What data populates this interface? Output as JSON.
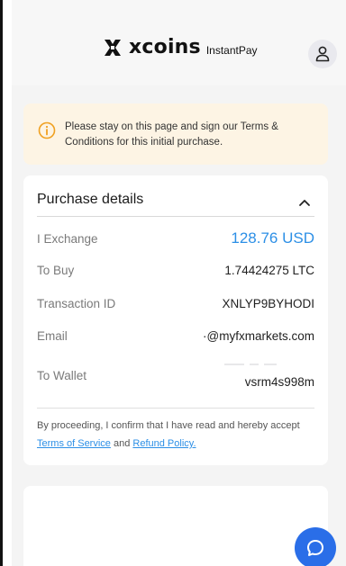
{
  "header": {
    "brand_word": "xcoins",
    "brand_sub": "InstantPay",
    "user_icon": "user-icon"
  },
  "notice": {
    "icon": "info-circle-icon",
    "line1": "Please stay on this page and sign our Terms &",
    "line2": "Conditions for this initial purchase."
  },
  "purchase": {
    "title": "Purchase details",
    "toggle_icon": "chevron-up-icon",
    "rows": [
      {
        "label": "I Exchange",
        "value": "128.76 USD"
      },
      {
        "label": "To Buy",
        "value": "1.74424275 LTC"
      },
      {
        "label": "Transaction ID",
        "value": "XNLYP9BYHODI"
      },
      {
        "label": "Email",
        "value": "·@myfxmarkets.com"
      },
      {
        "label": "To Wallet",
        "value": "vsrm4s998m"
      }
    ],
    "legal_prefix": "By proceeding, I confirm that I have read and hereby accept",
    "terms_link": "Terms of Service",
    "legal_and": "and",
    "refund_link": "Refund Policy."
  },
  "chat": {
    "icon": "chat-bubble-icon"
  },
  "colors": {
    "accent": "#2c8fe6",
    "chat": "#2a6ee8",
    "notice_bg": "#fdf4e4",
    "notice_icon": "#f0a020"
  }
}
